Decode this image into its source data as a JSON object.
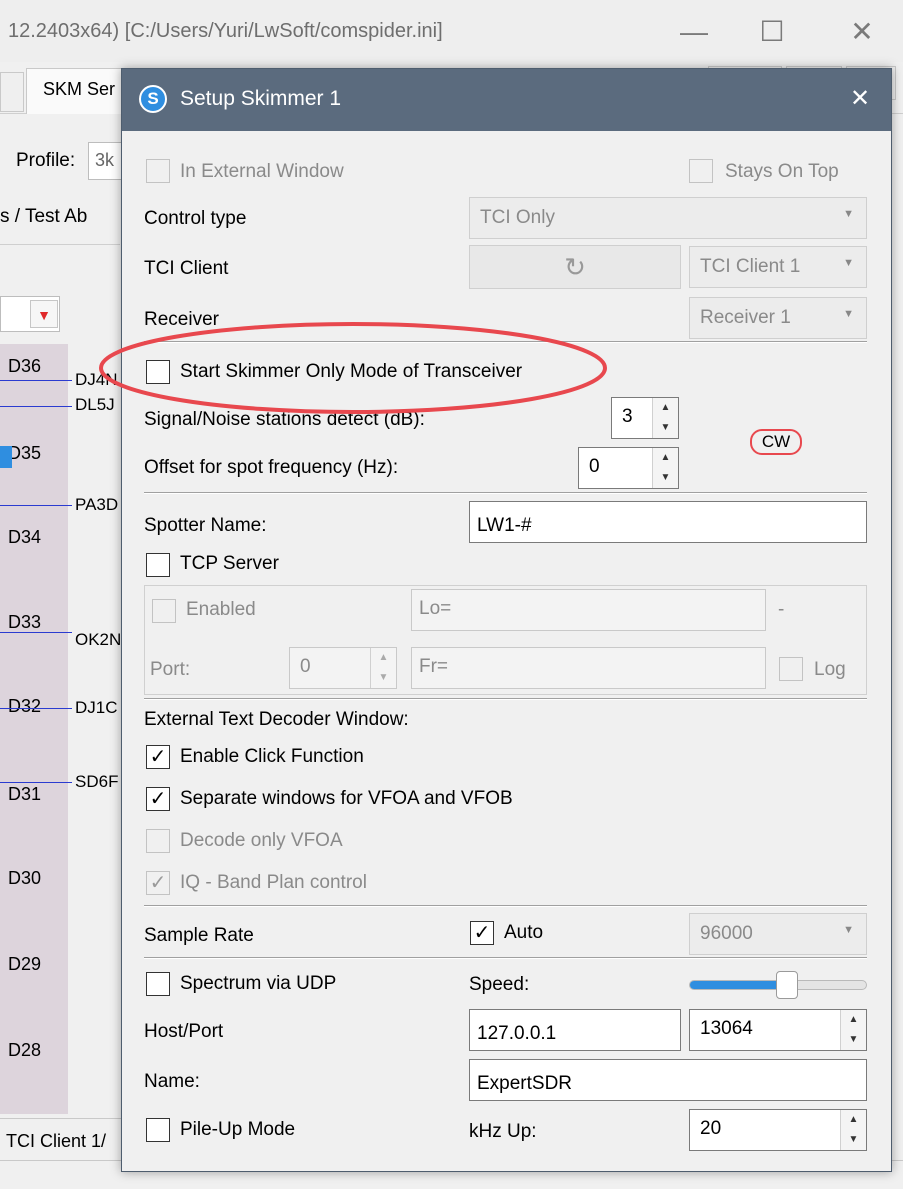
{
  "background": {
    "title": "12.2403x64) [C:/Users/Yuri/LwSoft/comspider.ini]",
    "window_controls": [
      "—",
      "☐",
      "✕"
    ],
    "active_tab": "SKM Ser",
    "profile_label": "Profile:",
    "profile_value": "3k",
    "tabs2": "s /  Test Ab",
    "scale_labels": [
      "D36",
      "D35",
      "D34",
      "D33",
      "D32",
      "D31",
      "D30",
      "D29",
      "D28"
    ],
    "spot_labels": [
      "DJ4N",
      "DL5J",
      "PA3D",
      "OK2N",
      "DJ1C",
      "SD6F"
    ],
    "status_text": "TCI Client 1/"
  },
  "dialog": {
    "title": "Setup Skimmer 1",
    "icon_glyph": "S",
    "close_glyph": "✕",
    "in_external_window": {
      "label": "In External Window",
      "checked": false,
      "enabled": false
    },
    "stays_on_top": {
      "label": "Stays On Top",
      "checked": false,
      "enabled": false
    },
    "control_type": {
      "label": "Control type",
      "value": "TCI Only"
    },
    "tci_client": {
      "label": "TCI Client",
      "value": "TCI Client 1",
      "refresh_glyph": "↻"
    },
    "receiver": {
      "label": "Receiver",
      "value": "Receiver 1"
    },
    "start_skimmer_only": {
      "label": "Start Skimmer Only Mode of Transceiver",
      "checked": false
    },
    "snr_detect": {
      "label": "Signal/Noise stations detect (dB):",
      "value": "3"
    },
    "cw_badge": "CW",
    "offset": {
      "label": "Offset for spot frequency (Hz):",
      "value": "0"
    },
    "spotter_name": {
      "label": "Spotter Name:",
      "value": "LW1-#"
    },
    "tcp_server": {
      "label": "TCP Server",
      "checked": false
    },
    "tcp_enabled": {
      "label": "Enabled",
      "checked": false
    },
    "lo_field": "Lo=",
    "dash": "-",
    "port": {
      "label": "Port:",
      "value": "0"
    },
    "fr_field": "Fr=",
    "log": {
      "label": "Log",
      "checked": false
    },
    "ext_decoder_heading": "External Text Decoder Window:",
    "enable_click": {
      "label": "Enable Click Function",
      "checked": true
    },
    "separate_windows": {
      "label": "Separate windows for VFOA and VFOB",
      "checked": true
    },
    "decode_only_vfoa": {
      "label": "Decode only VFOA",
      "checked": false,
      "enabled": false
    },
    "iq_band_plan": {
      "label": "IQ - Band Plan control",
      "checked": true,
      "enabled": false
    },
    "sample_rate": {
      "label": "Sample Rate",
      "auto_label": "Auto",
      "auto_checked": true,
      "value": "96000"
    },
    "spectrum_udp": {
      "label": "Spectrum via UDP",
      "checked": false
    },
    "speed": {
      "label": "Speed:",
      "level": 0.55
    },
    "host_port": {
      "label": "Host/Port",
      "host": "127.0.0.1",
      "port": "13064"
    },
    "name": {
      "label": "Name:",
      "value": "ExpertSDR"
    },
    "pile_up": {
      "label": "Pile-Up Mode",
      "checked": false
    },
    "khz_up": {
      "label": "kHz Up:",
      "value": "20"
    },
    "colors": {
      "titlebar": "#5b6b7e",
      "annotation_red": "#e8484e",
      "slider_fill": "#2f8ee0"
    }
  }
}
